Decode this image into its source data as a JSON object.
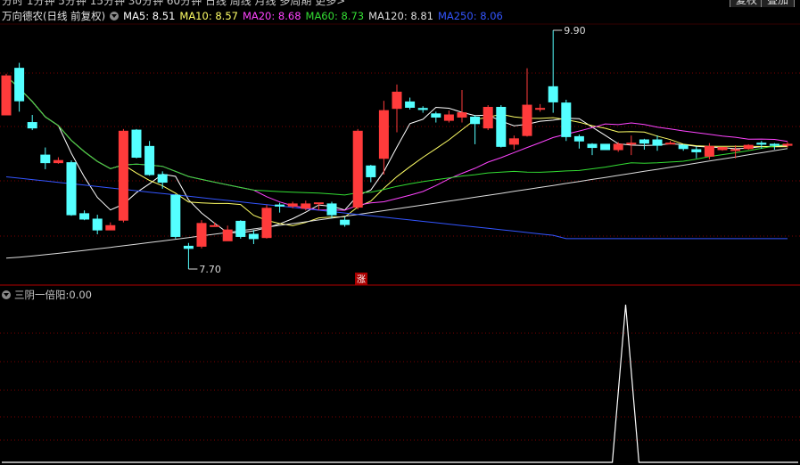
{
  "top_bar": {
    "periods_text": "分时  1分钟  5分钟  15分钟  30分钟  60分钟  日线  周线  月线  多周期  更多>",
    "restore_label": "复权",
    "overlay_label": "叠加"
  },
  "main_header": {
    "title": "万向德农(日线 前复权)",
    "ma": [
      {
        "label": "MA5:",
        "value": "8.51",
        "color": "#ffffff"
      },
      {
        "label": "MA10:",
        "value": "8.57",
        "color": "#ffff66"
      },
      {
        "label": "MA20:",
        "value": "8.68",
        "color": "#ff44ff"
      },
      {
        "label": "MA60:",
        "value": "8.73",
        "color": "#33dd33"
      },
      {
        "label": "MA120:",
        "value": "8.81",
        "color": "#dddddd"
      },
      {
        "label": "MA250:",
        "value": "8.06",
        "color": "#3355ff"
      }
    ]
  },
  "annotations": {
    "high_label": "9.90",
    "low_label": "7.70",
    "limit_up_badge": "涨"
  },
  "indicator": {
    "name": "三阴一倍阳",
    "value": "0.00"
  },
  "colors": {
    "up": "#ff3b3b",
    "down": "#54ffff",
    "grid": "#7a0000",
    "divider": "#b00000"
  },
  "chart_data": {
    "type": "candlestick",
    "price_range": [
      7.7,
      9.9
    ],
    "candles_ohlc": [
      [
        9.12,
        9.48,
        9.5,
        9.2
      ],
      [
        9.55,
        9.25,
        9.6,
        9.15
      ],
      [
        9.05,
        9.0,
        9.12,
        8.98
      ],
      [
        8.75,
        8.68,
        8.82,
        8.62
      ],
      [
        8.68,
        8.7,
        8.73,
        8.67
      ],
      [
        8.68,
        8.2,
        8.7,
        8.19
      ],
      [
        8.21,
        8.16,
        8.24,
        8.15
      ],
      [
        8.16,
        8.06,
        8.2,
        8.02
      ],
      [
        8.06,
        8.1,
        8.13,
        8.06
      ],
      [
        8.15,
        8.97,
        8.99,
        8.13
      ],
      [
        8.98,
        8.73,
        8.99,
        8.72
      ],
      [
        8.83,
        8.57,
        8.88,
        8.56
      ],
      [
        8.57,
        8.5,
        8.6,
        8.44
      ],
      [
        8.38,
        8.0,
        8.39,
        7.98
      ],
      [
        7.91,
        7.89,
        7.94,
        7.7
      ],
      [
        7.91,
        8.12,
        8.15,
        7.89
      ],
      [
        8.1,
        8.1,
        8.13,
        8.09
      ],
      [
        7.96,
        8.06,
        8.1,
        7.96
      ],
      [
        8.14,
        8.0,
        8.15,
        7.98
      ],
      [
        8.02,
        7.98,
        8.06,
        7.93
      ],
      [
        7.99,
        8.26,
        8.29,
        7.98
      ],
      [
        8.29,
        8.28,
        8.31,
        8.22
      ],
      [
        8.28,
        8.3,
        8.32,
        8.26
      ],
      [
        8.26,
        8.3,
        8.33,
        8.24
      ],
      [
        8.31,
        8.31,
        8.31,
        8.24
      ],
      [
        8.3,
        8.2,
        8.32,
        8.17
      ],
      [
        8.15,
        8.11,
        8.18,
        8.09
      ],
      [
        8.27,
        8.97,
        8.99,
        8.25
      ],
      [
        8.65,
        8.55,
        8.66,
        8.5
      ],
      [
        8.72,
        9.16,
        9.25,
        8.57
      ],
      [
        9.18,
        9.33,
        9.4,
        8.96
      ],
      [
        9.24,
        9.19,
        9.28,
        9.17
      ],
      [
        9.18,
        9.17,
        9.2,
        9.14
      ],
      [
        9.13,
        9.1,
        9.15,
        9.05
      ],
      [
        9.07,
        9.12,
        9.16,
        9.05
      ],
      [
        9.1,
        9.14,
        9.35,
        9.05
      ],
      [
        9.1,
        9.04,
        9.12,
        8.85
      ],
      [
        9.0,
        9.19,
        9.21,
        8.98
      ],
      [
        9.19,
        8.83,
        9.21,
        8.82
      ],
      [
        8.85,
        8.9,
        8.93,
        8.8
      ],
      [
        8.93,
        9.21,
        9.55,
        8.92
      ],
      [
        9.18,
        9.18,
        9.22,
        9.15
      ],
      [
        9.38,
        9.24,
        9.9,
        9.14
      ],
      [
        9.23,
        8.92,
        9.26,
        8.88
      ],
      [
        8.92,
        8.88,
        8.94,
        8.81
      ],
      [
        8.85,
        8.82,
        8.86,
        8.75
      ],
      [
        8.85,
        8.8,
        8.85,
        8.8
      ],
      [
        8.8,
        8.85,
        8.87,
        8.78
      ],
      [
        8.86,
        8.86,
        8.93,
        8.75
      ],
      [
        8.89,
        8.86,
        8.9,
        8.8
      ],
      [
        8.89,
        8.84,
        8.93,
        8.79
      ],
      [
        8.86,
        8.86,
        8.88,
        8.85
      ],
      [
        8.84,
        8.81,
        8.85,
        8.79
      ],
      [
        8.8,
        8.78,
        8.83,
        8.72
      ],
      [
        8.74,
        8.83,
        8.86,
        8.71
      ],
      [
        8.8,
        8.82,
        8.82,
        8.79
      ],
      [
        8.8,
        8.8,
        8.84,
        8.72
      ],
      [
        8.81,
        8.84,
        8.85,
        8.8
      ],
      [
        8.86,
        8.85,
        8.88,
        8.81
      ],
      [
        8.85,
        8.84,
        8.86,
        8.8
      ],
      [
        8.84,
        8.85,
        8.87,
        8.82
      ]
    ],
    "indicator_values": [
      0,
      0,
      0,
      0,
      0,
      0,
      0,
      0,
      0,
      0,
      0,
      0,
      0,
      0,
      0,
      0,
      0,
      0,
      0,
      0,
      0,
      0,
      0,
      0,
      0,
      0,
      0,
      0,
      0,
      0,
      0,
      0,
      0,
      0,
      0,
      0,
      0,
      0,
      0,
      0,
      0,
      0,
      0,
      0,
      0,
      0,
      0,
      1,
      0,
      0,
      0,
      0,
      0,
      0,
      0,
      0,
      0,
      0,
      0,
      0,
      0
    ]
  }
}
